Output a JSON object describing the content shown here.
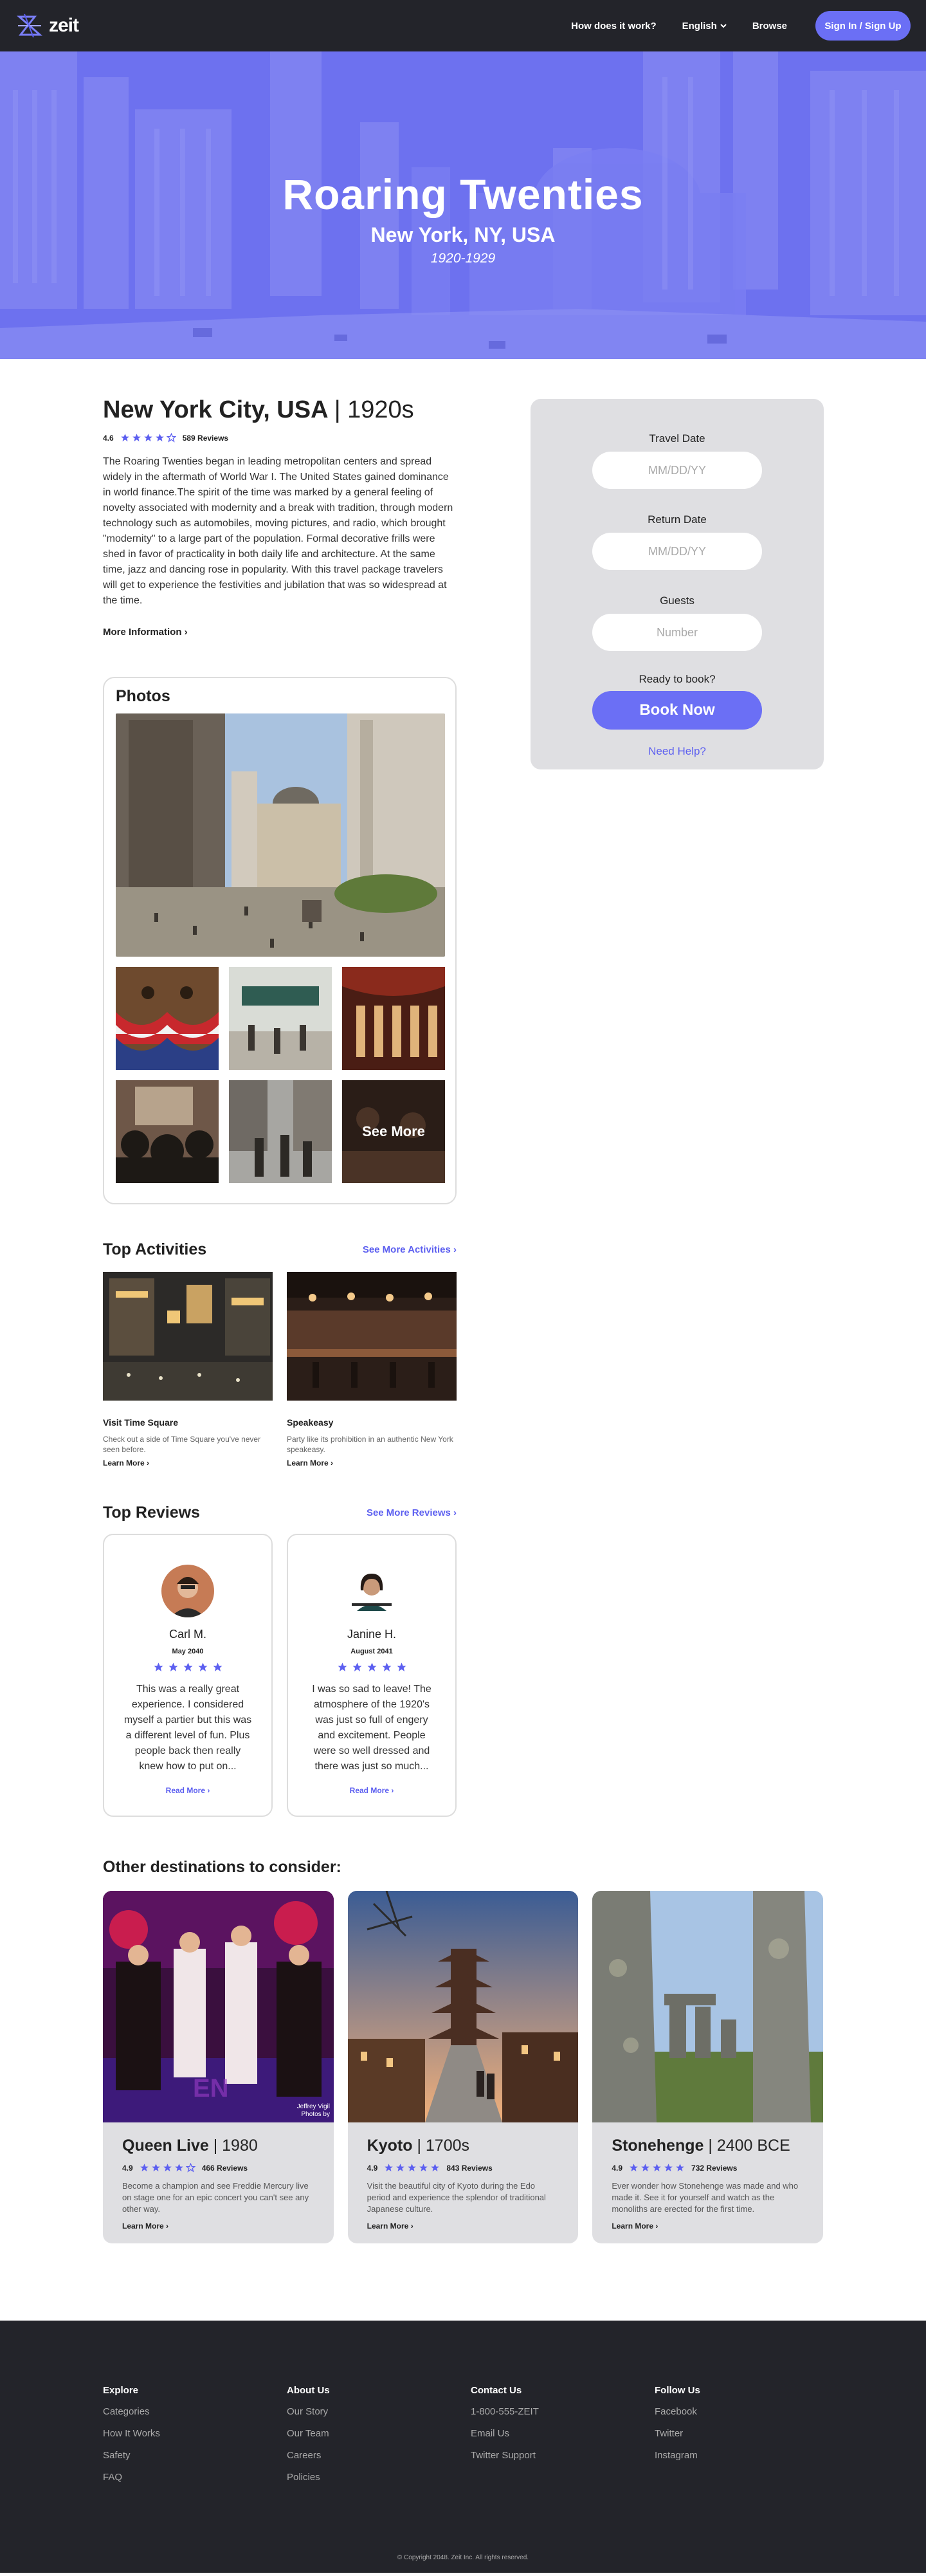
{
  "nav": {
    "logo_text": "zeit",
    "links": [
      "How does it work?",
      "English",
      "Browse"
    ],
    "signin": "Sign In / Sign Up"
  },
  "hero": {
    "title": "Roaring Twenties",
    "location": "New York, NY, USA",
    "years": "1920-1929"
  },
  "destination": {
    "city": "New York City, USA",
    "era": "1920s",
    "rating": "4.6",
    "reviews": "589 Reviews",
    "description": "The Roaring Twenties began in leading metropolitan centers and spread widely in the aftermath of World War I. The United States gained dominance in world finance.The spirit of the time was marked by a general feeling of novelty associated with modernity and a break with tradition, through modern technology such as automobiles, moving pictures, and radio, which brought \"modernity\" to a large part of the population. Formal decorative frills were shed in favor of practicality in both daily life and architecture. At the same time, jazz and dancing rose in popularity. With this travel package travelers will get to experience the festivities and jubilation that was so widespread at the time.",
    "more_info": "More Information ›"
  },
  "booking": {
    "travel_label": "Travel Date",
    "travel_placeholder": "MM/DD/YY",
    "return_label": "Return Date",
    "return_placeholder": "MM/DD/YY",
    "guests_label": "Guests",
    "guests_placeholder": "Number",
    "ready": "Ready to book?",
    "book": "Book Now",
    "help": "Need Help?"
  },
  "photos": {
    "title": "Photos",
    "see_more": "See More"
  },
  "activities": {
    "title": "Top Activities",
    "see_more": "See More Activities ›",
    "items": [
      {
        "name": "Visit Time Square",
        "desc": "Check out a side of Time Square you've never seen before.",
        "link": "Learn More ›"
      },
      {
        "name": "Speakeasy",
        "desc": "Party like its prohibition in an authentic New York speakeasy.",
        "link": "Learn More ›"
      }
    ]
  },
  "reviews": {
    "title": "Top Reviews",
    "see_more": "See More Reviews ›",
    "items": [
      {
        "name": "Carl M.",
        "date": "May 2040",
        "text": "This was a really great experience. I considered myself a partier but this was a different level of fun. Plus people back then really knew how to put on...",
        "link": "Read More ›"
      },
      {
        "name": "Janine H.",
        "date": "August 2041",
        "text": "I was so sad to leave! The atmosphere of the 1920's was just so full of engery and excitement. People were so well dressed and there was just so much...",
        "link": "Read More ›"
      }
    ]
  },
  "other": {
    "title": "Other destinations to consider:",
    "items": [
      {
        "name": "Queen Live",
        "era": "1980",
        "rating": "4.9",
        "reviews": "466 Reviews",
        "desc": "Become a champion and see Freddie Mercury live on stage one for an epic concert you can't see any other way.",
        "link": "Learn More ›",
        "credit": "Jeffrey Vigil\nPhotos by"
      },
      {
        "name": "Kyoto",
        "era": "1700s",
        "rating": "4.9",
        "reviews": "843 Reviews",
        "desc": "Visit the beautiful city of Kyoto during the Edo period and experience the splendor of traditional Japanese culture.",
        "link": "Learn More ›"
      },
      {
        "name": "Stonehenge",
        "era": "2400 BCE",
        "rating": "4.9",
        "reviews": "732 Reviews",
        "desc": "Ever wonder how Stonehenge was made and who made it. See it for yourself and watch as the monoliths are erected for the first time.",
        "link": "Learn More ›"
      }
    ]
  },
  "footer": {
    "columns": [
      {
        "title": "Explore",
        "links": [
          "Categories",
          "How It Works",
          "Safety",
          "FAQ"
        ]
      },
      {
        "title": "About Us",
        "links": [
          "Our Story",
          "Our Team",
          "Careers",
          "Policies"
        ]
      },
      {
        "title": "Contact Us",
        "links": [
          "1-800-555-ZEIT",
          "Email Us",
          "Twitter Support"
        ]
      },
      {
        "title": "Follow Us",
        "links": [
          "Facebook",
          "Twitter",
          "Instagram"
        ]
      }
    ],
    "copyright": "© Copyright 2048. Zeit Inc. All rights reserved."
  },
  "colors": {
    "accent": "#6b6ff5",
    "nav": "#23242a",
    "card": "#dfdfe2"
  }
}
